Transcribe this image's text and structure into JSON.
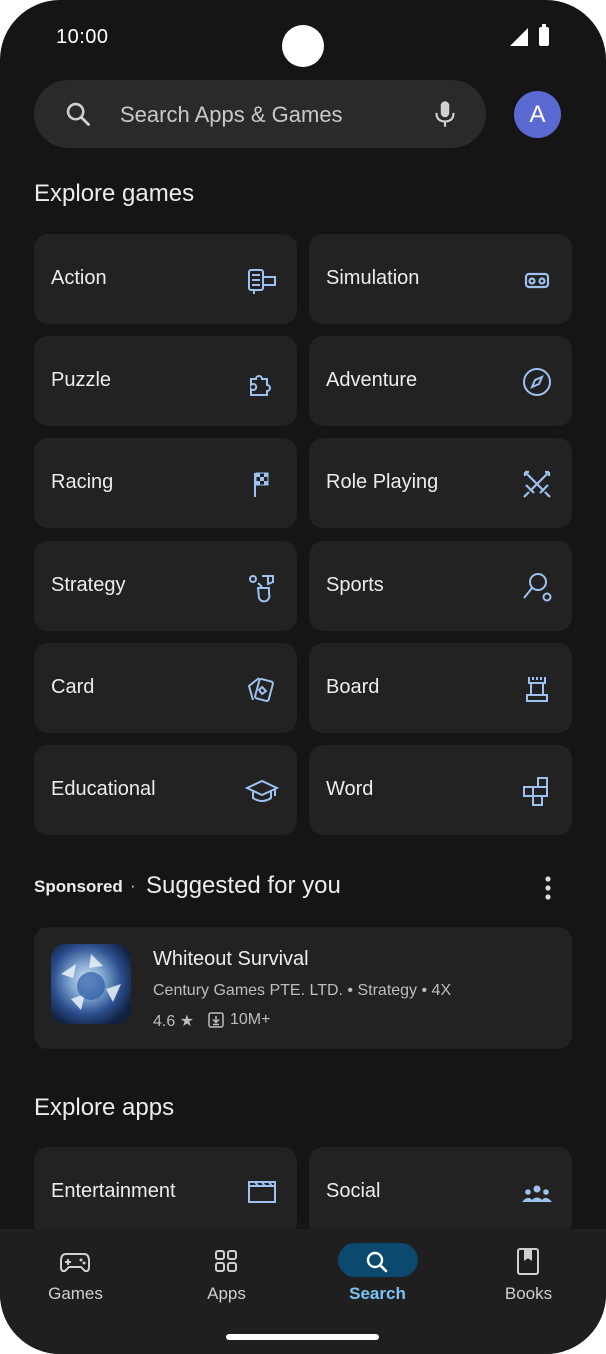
{
  "status_bar": {
    "time": "10:00"
  },
  "search": {
    "placeholder": "Search Apps & Games",
    "avatar_letter": "A"
  },
  "explore_games": {
    "title": "Explore games",
    "categories": [
      {
        "label": "Action",
        "icon": "arcade-icon"
      },
      {
        "label": "Simulation",
        "icon": "vr-headset-icon"
      },
      {
        "label": "Puzzle",
        "icon": "puzzle-icon"
      },
      {
        "label": "Adventure",
        "icon": "compass-icon"
      },
      {
        "label": "Racing",
        "icon": "checkered-flag-icon"
      },
      {
        "label": "Role Playing",
        "icon": "crossed-swords-icon"
      },
      {
        "label": "Strategy",
        "icon": "strategy-icon"
      },
      {
        "label": "Sports",
        "icon": "racket-icon"
      },
      {
        "label": "Card",
        "icon": "cards-icon"
      },
      {
        "label": "Board",
        "icon": "chess-rook-icon"
      },
      {
        "label": "Educational",
        "icon": "graduation-cap-icon"
      },
      {
        "label": "Word",
        "icon": "word-blocks-icon"
      }
    ]
  },
  "suggested": {
    "sponsored_label": "Sponsored",
    "separator": "·",
    "title": "Suggested for you",
    "app": {
      "name": "Whiteout Survival",
      "meta": "Century Games PTE. LTD. • Strategy • 4X",
      "rating": "4.6 ★",
      "downloads": "10M+"
    }
  },
  "explore_apps": {
    "title": "Explore apps",
    "categories": [
      {
        "label": "Entertainment",
        "icon": "clapperboard-icon"
      },
      {
        "label": "Social",
        "icon": "people-icon"
      }
    ]
  },
  "bottom_nav": {
    "items": [
      {
        "label": "Games",
        "icon": "gamepad-icon"
      },
      {
        "label": "Apps",
        "icon": "apps-grid-icon"
      },
      {
        "label": "Search",
        "icon": "search-icon",
        "active": true
      },
      {
        "label": "Books",
        "icon": "book-icon"
      }
    ]
  },
  "colors": {
    "accent": "#7cc4f5",
    "icon": "#9ec2f0",
    "tile": "#222222",
    "background": "#151515"
  }
}
